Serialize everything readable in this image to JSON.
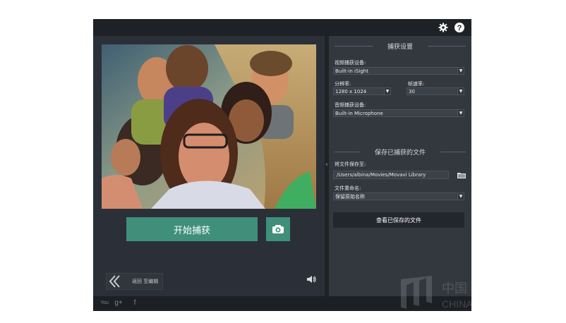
{
  "titlebar": {
    "settings_icon": "gear-icon",
    "help_icon": "question-icon"
  },
  "main": {
    "start_capture_label": "开始捕获",
    "camera_icon": "camera-icon",
    "back_to_editor_label": "返回 至编辑",
    "speaker_icon": "speaker-icon"
  },
  "settings": {
    "capture_settings_title": "捕获设置",
    "video_device_label": "视频捕获设备:",
    "video_device_value": "Built-in iSight",
    "resolution_label": "分辨率:",
    "resolution_value": "1280 x 1024",
    "frame_rate_label": "帧速率:",
    "frame_rate_value": "30",
    "audio_device_label": "音频捕获设备:",
    "audio_device_value": "Built-in Microphone"
  },
  "save": {
    "title": "保存已捕获的文件",
    "save_to_label": "将文件保存至:",
    "path_value": "/Users/albina/Movies/Movavi Library",
    "folder_icon": "folder-icon",
    "naming_label": "文件重命名:",
    "naming_value": "保留原始名称",
    "view_saved_label": "查看已保存的文件"
  },
  "footer": {
    "youtube_label": "You",
    "googleplus_label": "g+",
    "facebook_label": "f"
  },
  "watermark": {
    "text_cn": "中国",
    "text_en": "CHINA"
  },
  "colors": {
    "accent": "#3f8f7a",
    "titlebar": "#1e2227",
    "left_bg": "#2b3038",
    "right_bg": "#33383f"
  }
}
